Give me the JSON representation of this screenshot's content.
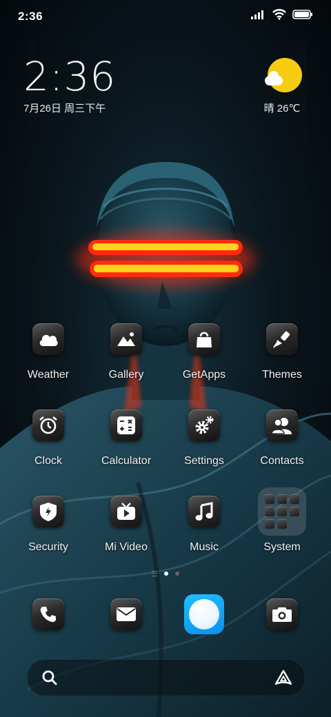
{
  "status_bar": {
    "time": "2:36",
    "icons": [
      "signal-icon",
      "wifi-icon",
      "battery-icon"
    ]
  },
  "clock_widget": {
    "time": "2:36",
    "date": "7月26日 周三下午"
  },
  "weather_widget": {
    "icon": "sun-cloud-icon",
    "text": "晴 26℃"
  },
  "apps": [
    {
      "label": "Weather",
      "icon": "weather-cloud-icon"
    },
    {
      "label": "Gallery",
      "icon": "gallery-image-icon"
    },
    {
      "label": "GetApps",
      "icon": "shopping-bag-icon"
    },
    {
      "label": "Themes",
      "icon": "paint-brush-icon"
    },
    {
      "label": "Clock",
      "icon": "alarm-clock-icon"
    },
    {
      "label": "Calculator",
      "icon": "calculator-icon"
    },
    {
      "label": "Settings",
      "icon": "gear-icon"
    },
    {
      "label": "Contacts",
      "icon": "contacts-icon"
    },
    {
      "label": "Security",
      "icon": "security-shield-icon"
    },
    {
      "label": "Mi Video",
      "icon": "tv-play-icon"
    },
    {
      "label": "Music",
      "icon": "music-note-icon"
    },
    {
      "label": "System",
      "icon": "folder-icon"
    }
  ],
  "page_indicator": {
    "pages": 2,
    "active": 1
  },
  "dock": [
    {
      "name": "phone",
      "icon": "phone-icon"
    },
    {
      "name": "messages",
      "icon": "mail-icon"
    },
    {
      "name": "browser",
      "icon": "browser-icon"
    },
    {
      "name": "camera",
      "icon": "camera-icon"
    }
  ],
  "search_bar": {
    "left_icon": "search-icon",
    "right_icon": "assistant-icon"
  },
  "colors": {
    "accent_sun": "#f6cb10",
    "browser_blue": "#0b8ef0",
    "neon_red": "#ff2a10",
    "neon_yellow": "#ffd21a",
    "wallpaper_teal": "#1e4a5a"
  }
}
